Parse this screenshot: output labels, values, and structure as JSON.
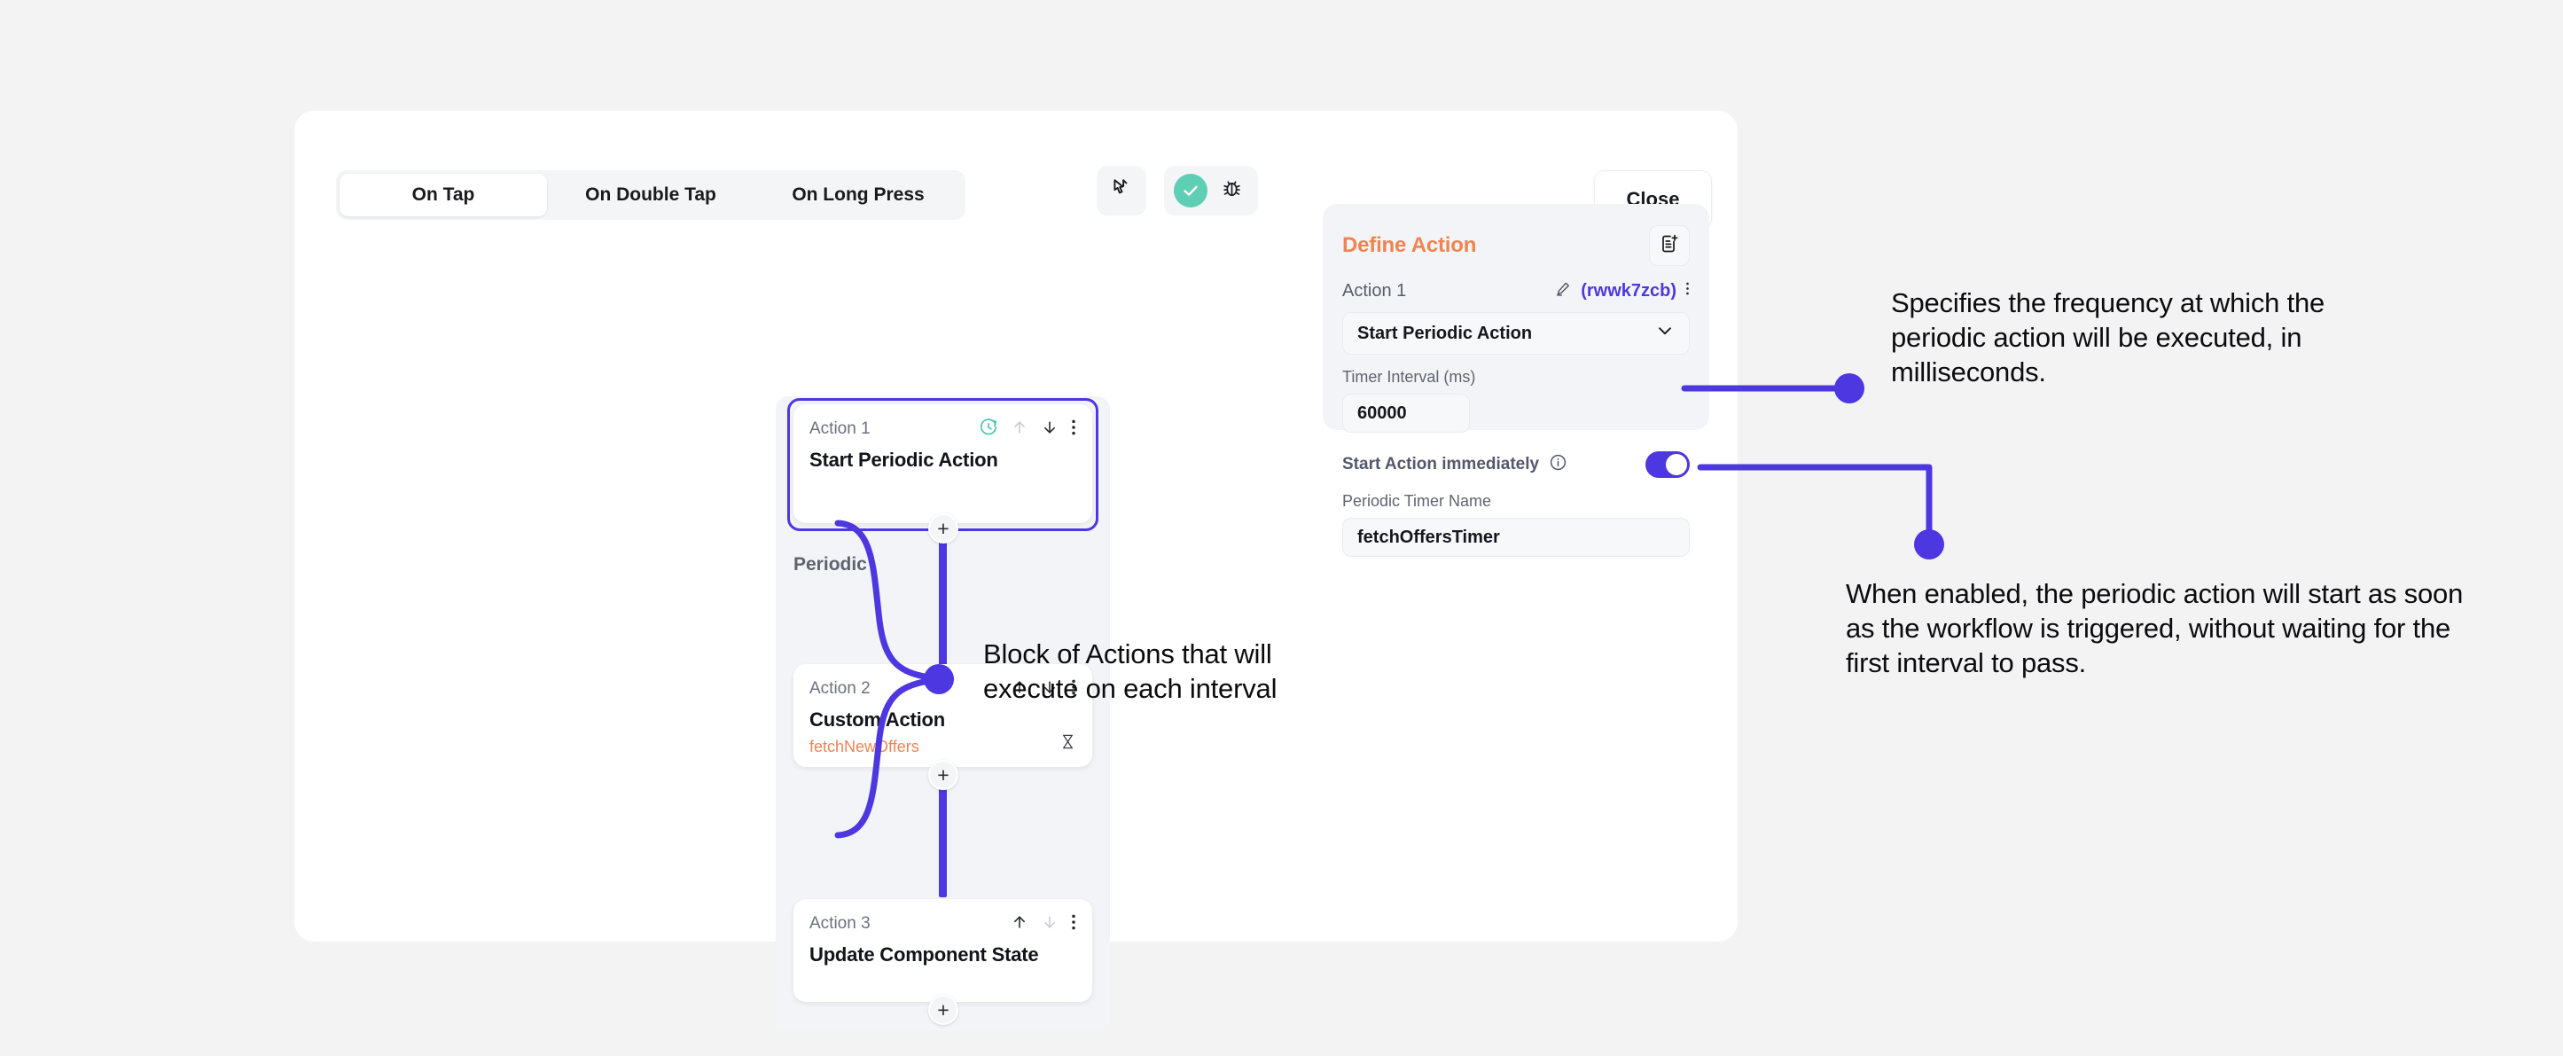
{
  "theme": {
    "page_bg": "#f3f3f4",
    "panel_bg": "#f3f4f7",
    "accent_blue": "#4d37e0",
    "accent_orange": "#ef8450",
    "accent_green": "#5ecfb4"
  },
  "tabs": [
    {
      "label": "On Tap",
      "active": true
    },
    {
      "label": "On Double Tap",
      "active": false
    },
    {
      "label": "On Long Press",
      "active": false
    }
  ],
  "toolbar": {
    "pointer_icon": "cursor-pointer-icon",
    "check_icon": "check-circle-icon",
    "bug_icon": "bug-icon"
  },
  "close_button": {
    "label": "Close"
  },
  "flow": {
    "group_label": "Periodic",
    "add_node_label": "+",
    "cards": [
      {
        "index_label": "Action 1",
        "title": "Start Periodic Action",
        "subtitle": "",
        "selected": true,
        "icons": [
          "timer-refresh-icon",
          "move-up-icon",
          "move-down-icon",
          "more-options-icon"
        ]
      },
      {
        "index_label": "Action 2",
        "title": "Custom Action",
        "subtitle": "fetchNewOffers",
        "selected": false,
        "icons": [
          "move-up-icon",
          "move-down-icon",
          "more-options-icon",
          "hourglass-off-icon"
        ]
      },
      {
        "index_label": "Action 3",
        "title": "Update Component State",
        "subtitle": "",
        "selected": false,
        "icons": [
          "move-up-icon",
          "move-down-icon",
          "more-options-icon"
        ]
      }
    ]
  },
  "define_panel": {
    "title": "Define Action",
    "add_note_icon": "add-note-icon",
    "action_label": "Action 1",
    "action_id": "(rwwk7zcb)",
    "edit_icon": "pencil-icon",
    "more_icon": "more-options-icon",
    "action_type_value": "Start Periodic Action",
    "timer_interval_label": "Timer Interval (ms)",
    "timer_interval_value": "60000",
    "start_immediately_label": "Start Action immediately",
    "start_immediately_info_icon": "info-icon",
    "start_immediately_enabled": true,
    "timer_name_label": "Periodic Timer Name",
    "timer_name_value": "fetchOffersTimer"
  },
  "annotations": {
    "center": "Block of Actions that will execute on each interval",
    "top_right": "Specifies the frequency at which the periodic action will be executed, in milliseconds.",
    "bottom_right": "When enabled, the periodic action will start as soon as the workflow is triggered, without waiting for the first interval to pass."
  }
}
